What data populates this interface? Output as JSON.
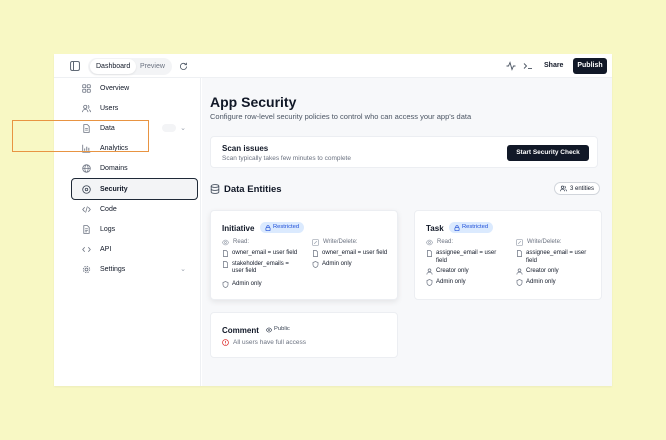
{
  "topbar": {
    "tabs": [
      {
        "label": "Dashboard",
        "active": true
      },
      {
        "label": "Preview",
        "active": false
      }
    ],
    "share_label": "Share",
    "publish_label": "Publish"
  },
  "sidebar": {
    "items": [
      {
        "label": "Overview",
        "icon": "grid-icon"
      },
      {
        "label": "Users",
        "icon": "users-icon"
      },
      {
        "label": "Data",
        "icon": "file-icon",
        "expandable": true
      },
      {
        "label": "Analytics",
        "icon": "chart-icon"
      },
      {
        "label": "Domains",
        "icon": "globe-icon"
      },
      {
        "label": "Security",
        "icon": "shield-icon",
        "selected": true
      },
      {
        "label": "Code",
        "icon": "code-icon"
      },
      {
        "label": "Logs",
        "icon": "doc-icon"
      },
      {
        "label": "API",
        "icon": "api-icon"
      },
      {
        "label": "Settings",
        "icon": "gear-icon",
        "expandable": true
      }
    ]
  },
  "main": {
    "title": "App Security",
    "subtitle": "Configure row-level security policies to control who can access your app's data",
    "scan": {
      "title": "Scan issues",
      "subtitle": "Scan typically takes few minutes to complete",
      "button": "Start Security Check"
    },
    "entities_title": "Data Entities",
    "entities_count": "3 entities",
    "entities": [
      {
        "name": "Initiative",
        "badge": "Restricted",
        "read_label": "Read:",
        "read": [
          "owner_email = user field",
          "stakeholder_emails = user field",
          "Admin only"
        ],
        "write_label": "Write/Delete:",
        "write": [
          "owner_email = user field",
          "Admin only"
        ]
      },
      {
        "name": "Task",
        "badge": "Restricted",
        "read_label": "Read:",
        "read": [
          "assignee_email = user field",
          "Creator only",
          "Admin only"
        ],
        "write_label": "Write/Delete:",
        "write": [
          "assignee_email = user field",
          "Creator only",
          "Admin only"
        ]
      },
      {
        "name": "Comment",
        "badge": "Public",
        "warning": "All users have full access"
      }
    ]
  },
  "colors": {
    "page_background": "#f8f8c4",
    "primary_button": "#111827",
    "highlight": "#e89442",
    "restricted_badge_bg": "#dbeafe",
    "restricted_badge_text": "#1d4ed8",
    "warning": "#dc2626"
  }
}
